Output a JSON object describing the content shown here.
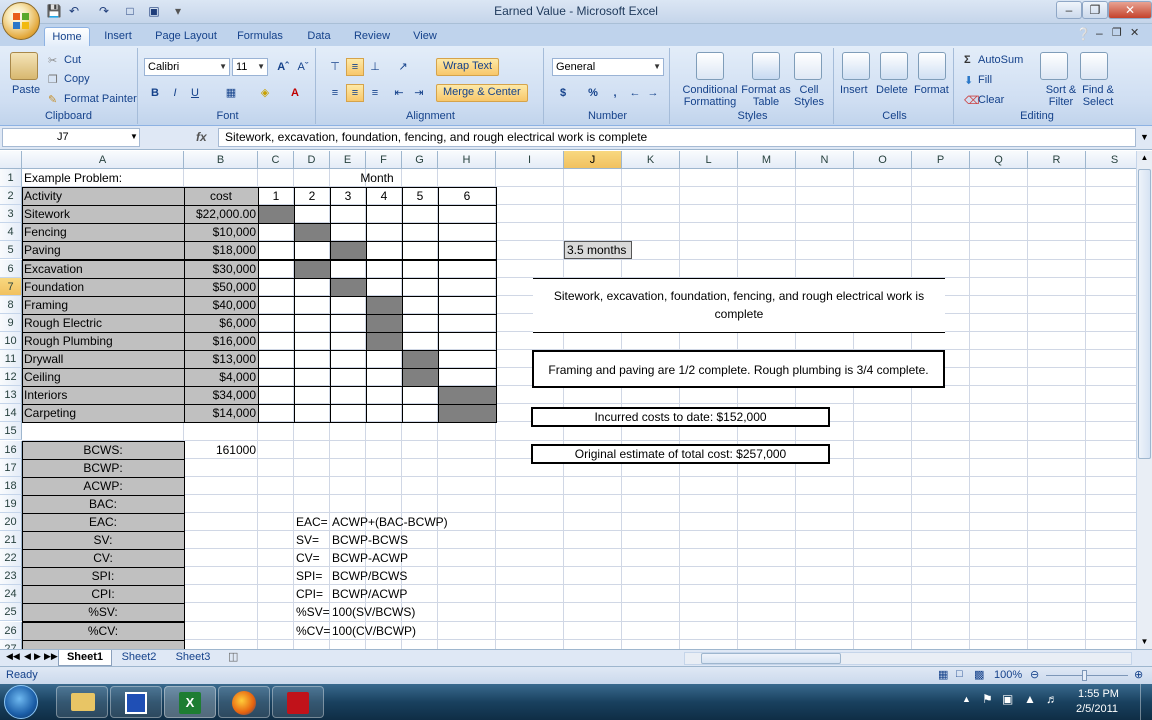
{
  "window": {
    "title": "Earned Value - Microsoft Excel"
  },
  "ribbon_tabs": [
    "Home",
    "Insert",
    "Page Layout",
    "Formulas",
    "Data",
    "Review",
    "View"
  ],
  "ribbon": {
    "clipboard": {
      "paste": "Paste",
      "cut": "Cut",
      "copy": "Copy",
      "format_painter": "Format Painter",
      "label": "Clipboard"
    },
    "font": {
      "name": "Calibri",
      "size": "11",
      "label": "Font",
      "bold": "B",
      "italic": "I",
      "underline": "U"
    },
    "alignment": {
      "wrap": "Wrap Text",
      "merge": "Merge & Center",
      "label": "Alignment"
    },
    "number": {
      "format": "General",
      "currency": "$",
      "percent": "%",
      "comma": ",",
      "label": "Number"
    },
    "styles": {
      "conditional": "Conditional Formatting",
      "format_table": "Format as Table",
      "cell_styles": "Cell Styles",
      "label": "Styles"
    },
    "cells": {
      "insert": "Insert",
      "delete": "Delete",
      "format": "Format",
      "label": "Cells"
    },
    "editing": {
      "autosum": "AutoSum",
      "fill": "Fill",
      "clear": "Clear",
      "sort": "Sort & Filter",
      "find": "Find & Select",
      "label": "Editing"
    }
  },
  "formula_bar": {
    "name_box": "J7",
    "fx": "fx",
    "content": "Sitework, excavation, foundation, fencing, and rough electrical work is complete"
  },
  "columns": [
    "A",
    "B",
    "C",
    "D",
    "E",
    "F",
    "G",
    "H",
    "I",
    "J",
    "K",
    "L",
    "M",
    "N",
    "O",
    "P",
    "Q",
    "R",
    "S"
  ],
  "rows": [
    "1",
    "2",
    "3",
    "4",
    "5",
    "6",
    "7",
    "8",
    "9",
    "10",
    "11",
    "12",
    "13",
    "14",
    "15",
    "16",
    "17",
    "18",
    "19",
    "20",
    "21",
    "22",
    "23",
    "24",
    "25",
    "26",
    "27"
  ],
  "sheet": {
    "a1": "Example Problem:",
    "month": "Month",
    "activity_header": "Activity",
    "cost_header": "cost",
    "months": [
      "1",
      "2",
      "3",
      "4",
      "5",
      "6"
    ],
    "activities": [
      {
        "name": "Sitework",
        "cost": "$22,000.00"
      },
      {
        "name": "Fencing",
        "cost": "$10,000"
      },
      {
        "name": "Paving",
        "cost": "$18,000"
      },
      {
        "name": "Excavation",
        "cost": "$30,000"
      },
      {
        "name": "Foundation",
        "cost": "$50,000"
      },
      {
        "name": "Framing",
        "cost": "$40,000"
      },
      {
        "name": "Rough Electric",
        "cost": "$6,000"
      },
      {
        "name": "Rough Plumbing",
        "cost": "$16,000"
      },
      {
        "name": "Drywall",
        "cost": "$13,000"
      },
      {
        "name": "Ceiling",
        "cost": "$4,000"
      },
      {
        "name": "Interiors",
        "cost": "$34,000"
      },
      {
        "name": "Carpeting",
        "cost": "$14,000"
      }
    ],
    "metrics": [
      "BCWS:",
      "BCWP:",
      "ACWP:",
      "BAC:",
      "EAC:",
      "SV:",
      "CV:",
      "SPI:",
      "CPI:",
      "%SV:",
      "%CV:"
    ],
    "bcws_value": "161000",
    "formulas": [
      {
        "k": "EAC=",
        "v": "ACWP+(BAC-BCWP)"
      },
      {
        "k": "SV=",
        "v": "BCWP-BCWS"
      },
      {
        "k": "CV=",
        "v": "BCWP-ACWP"
      },
      {
        "k": "SPI=",
        "v": "BCWP/BCWS"
      },
      {
        "k": "CPI=",
        "v": "BCWP/ACWP"
      },
      {
        "k": "%SV=",
        "v": "100(SV/BCWS)"
      },
      {
        "k": "%CV=",
        "v": "100(CV/BCWP)"
      }
    ],
    "time_box": "3.5 months",
    "box1": "Sitework, excavation, foundation, fencing, and rough electrical work is complete",
    "box2": "Framing and paving are 1/2 complete. Rough plumbing is 3/4 complete.",
    "box3": "Incurred costs to date: $152,000",
    "box4": "Original estimate of total cost: $257,000"
  },
  "sheet_tabs": [
    "Sheet1",
    "Sheet2",
    "Sheet3"
  ],
  "status": {
    "ready": "Ready",
    "zoom": "100%"
  },
  "clock": {
    "time": "1:55 PM",
    "date": "2/5/2011"
  }
}
